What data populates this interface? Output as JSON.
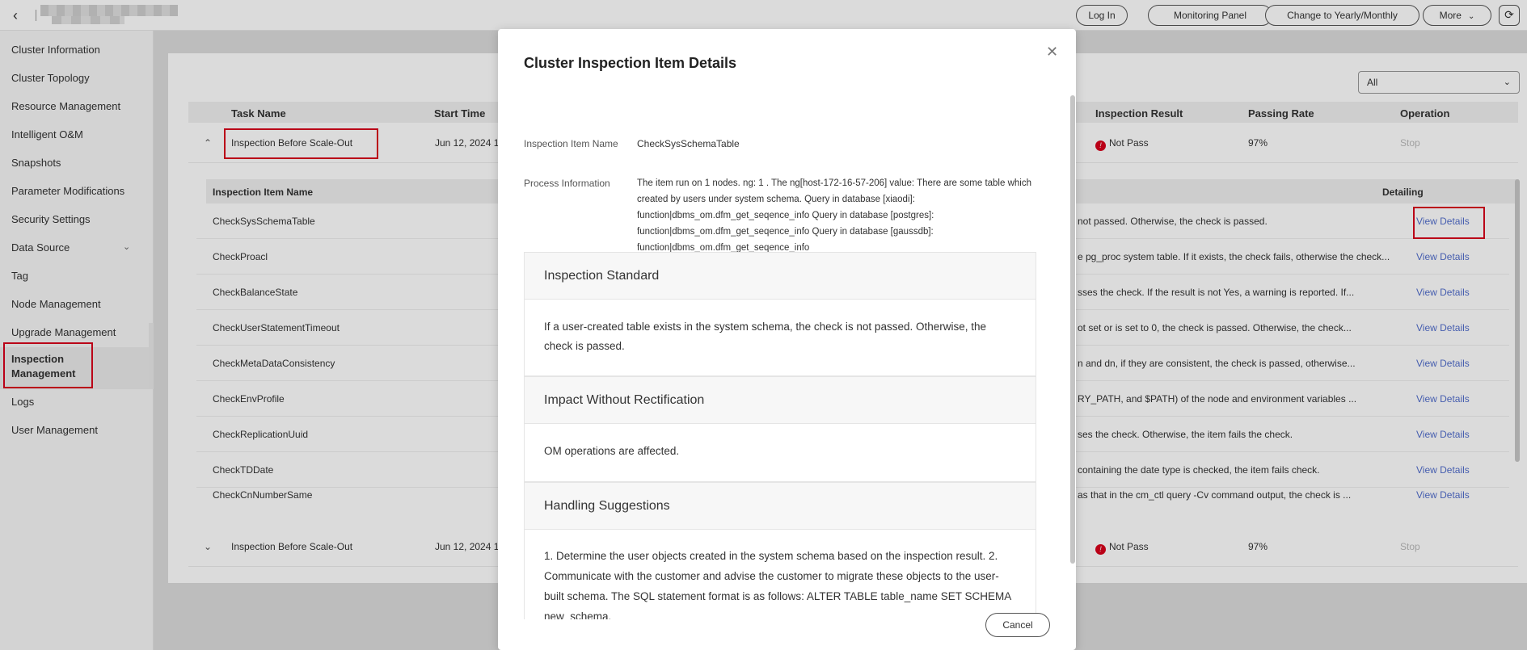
{
  "topbar": {
    "back_icon": "chevron-left-icon",
    "login": "Log In",
    "monitoring": "Monitoring Panel",
    "change": "Change to Yearly/Monthly",
    "more": "More",
    "refresh_icon": "refresh-icon"
  },
  "sidebar": {
    "items": [
      {
        "label": "Cluster Information"
      },
      {
        "label": "Cluster Topology"
      },
      {
        "label": "Resource Management"
      },
      {
        "label": "Intelligent O&M"
      },
      {
        "label": "Snapshots"
      },
      {
        "label": "Parameter Modifications"
      },
      {
        "label": "Security Settings"
      },
      {
        "label": "Data Source"
      },
      {
        "label": "Tag"
      },
      {
        "label": "Node Management"
      },
      {
        "label": "Upgrade Management"
      },
      {
        "label": "Inspection Management"
      },
      {
        "label": "Logs"
      },
      {
        "label": "User Management"
      }
    ],
    "active": "Inspection Management"
  },
  "filter": {
    "selected": "All"
  },
  "task_table": {
    "headers": [
      "Task Name",
      "Start Time",
      "Inspection Result",
      "Passing Rate",
      "Operation"
    ],
    "rows": [
      {
        "name": "Inspection Before Scale-Out",
        "start": "Jun 12, 2024 1",
        "result": "Not Pass",
        "rate": "97%",
        "op": "Stop",
        "expanded": true
      },
      {
        "name": "Inspection Before Scale-Out",
        "start": "Jun 12, 2024 1",
        "result": "Not Pass",
        "rate": "97%",
        "op": "Stop",
        "expanded": false
      }
    ]
  },
  "sub_table": {
    "headers": [
      "Inspection Item Name",
      "Detailing"
    ],
    "link_label": "View Details",
    "rows": [
      {
        "name": "CheckSysSchemaTable",
        "desc": "not passed. Otherwise, the check is passed."
      },
      {
        "name": "CheckProacl",
        "desc": "e pg_proc system table. If it exists, the check fails, otherwise the check..."
      },
      {
        "name": "CheckBalanceState",
        "desc": "sses the check. If the result is not Yes, a warning is reported. If..."
      },
      {
        "name": "CheckUserStatementTimeout",
        "desc": "ot set or is set to 0, the check is passed. Otherwise, the check..."
      },
      {
        "name": "CheckMetaDataConsistency",
        "desc": "n and dn, if they are consistent, the check is passed, otherwise..."
      },
      {
        "name": "CheckEnvProfile",
        "desc": "RY_PATH, and $PATH) of the node and environment variables ..."
      },
      {
        "name": "CheckReplicationUuid",
        "desc": "ses the check. Otherwise, the item fails the check."
      },
      {
        "name": "CheckTDDate",
        "desc": "containing the date type is checked, the item fails check."
      },
      {
        "name": "CheckCnNumberSame",
        "desc": "as that in the cm_ctl query -Cv command output, the check is ..."
      }
    ]
  },
  "modal": {
    "title": "Cluster Inspection Item Details",
    "close_icon": "close-icon",
    "item_name_label": "Inspection Item Name",
    "item_name_value": "CheckSysSchemaTable",
    "process_label": "Process Information",
    "process_value": "The item run on 1 nodes. ng: 1 . The ng[host-172-16-57-206] value: There are some table which created by users under system schema. Query in database [xiaodi]: function|dbms_om.dfm_get_seqence_info Query in database [postgres]: function|dbms_om.dfm_get_seqence_info Query in database [gaussdb]: function|dbms_om.dfm_get_seqence_info",
    "sections": [
      {
        "title": "Inspection Standard",
        "body": "If a user-created table exists in the system schema, the check is not passed. Otherwise, the check is passed."
      },
      {
        "title": "Impact Without Rectification",
        "body": "OM operations are affected."
      },
      {
        "title": "Handling Suggestions",
        "body": "1. Determine the user objects created in the system schema based on the inspection result. 2. Communicate with the customer and advise the customer to migrate these objects to the user-built schema. The SQL statement format is as follows: ALTER TABLE table_name SET SCHEMA new_schema."
      }
    ],
    "cancel": "Cancel"
  },
  "colors": {
    "accent_red": "#d9001b",
    "link_blue": "#526ecc"
  }
}
